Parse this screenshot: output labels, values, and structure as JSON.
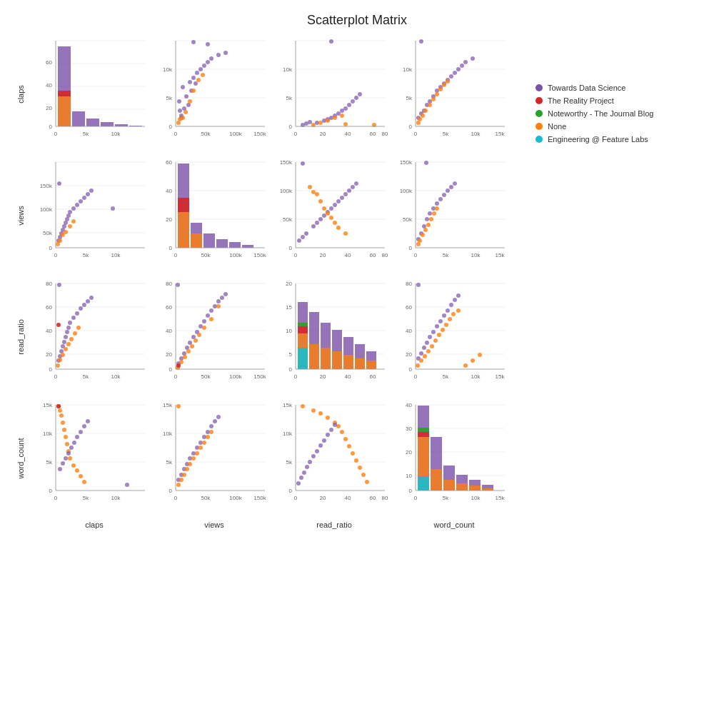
{
  "title": "Scatterplot Matrix",
  "legend": {
    "items": [
      {
        "label": "Towards Data Science",
        "color": "#7B52AB"
      },
      {
        "label": "The Reality Project",
        "color": "#D62728"
      },
      {
        "label": "Noteworthy - The Journal Blog",
        "color": "#2CA02C"
      },
      {
        "label": "None",
        "color": "#FF7F0E"
      },
      {
        "label": "Engineering @ Feature Labs",
        "color": "#17BECF"
      }
    ]
  },
  "row_labels": [
    "claps",
    "views",
    "read_ratio",
    "word_count"
  ],
  "col_labels": [
    "claps",
    "views",
    "read_ratio",
    "word_count"
  ],
  "x_axis_labels": {
    "claps": [
      "0",
      "5k",
      "10k"
    ],
    "views": [
      "0",
      "50k",
      "100k",
      "150k"
    ],
    "read_ratio": [
      "0",
      "20",
      "40",
      "60",
      "80"
    ],
    "word_count": [
      "0",
      "5k",
      "10k",
      "15k"
    ]
  }
}
